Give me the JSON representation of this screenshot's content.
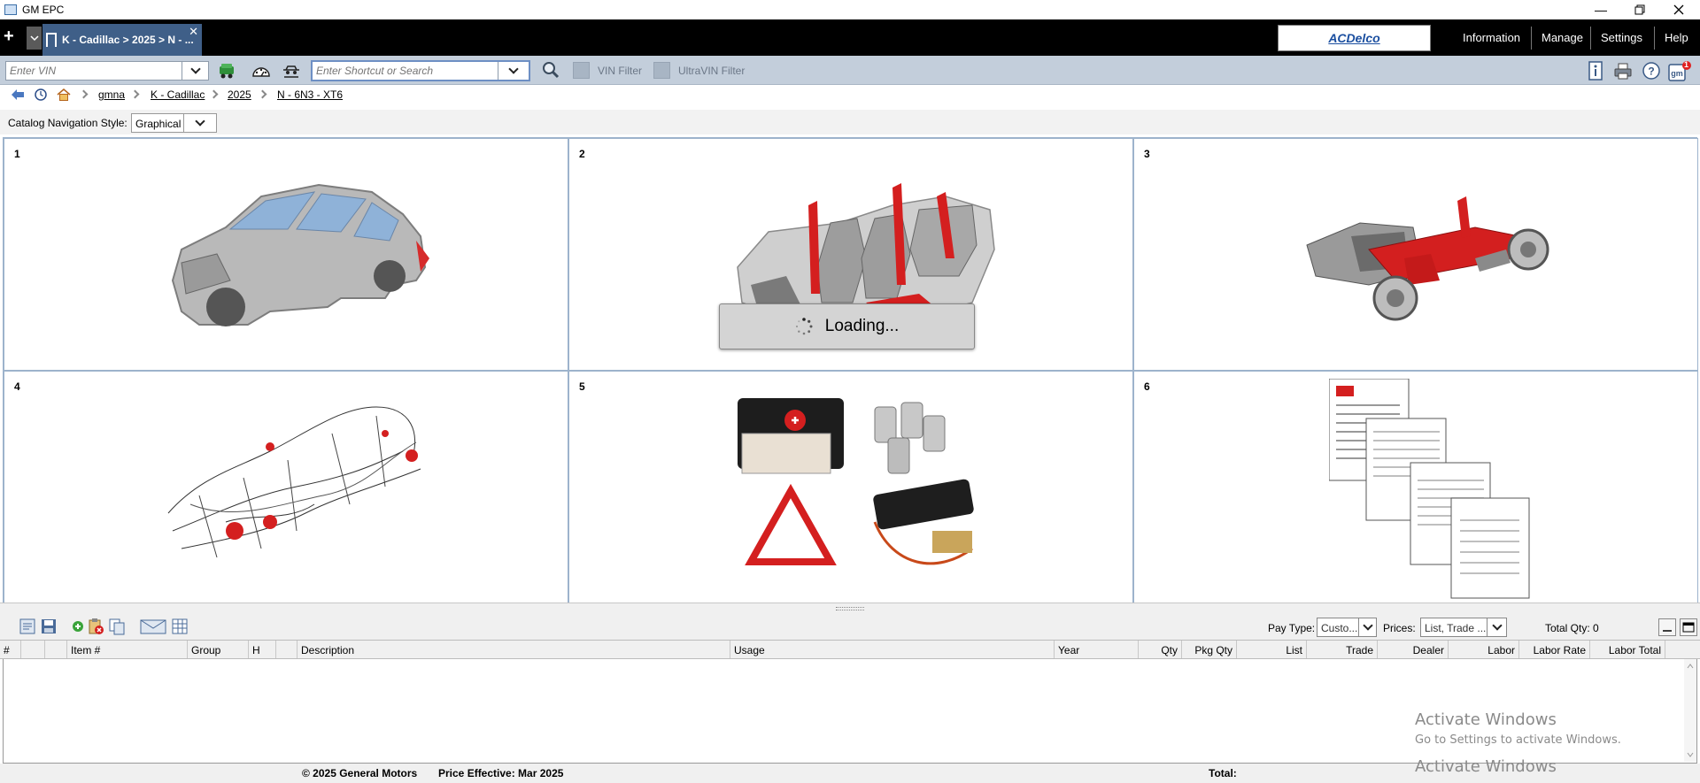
{
  "window": {
    "title": "GM EPC"
  },
  "topbar": {
    "tab_label": "K - Cadillac > 2025 > N - ...",
    "brand": "ACDelco",
    "nav": [
      "Information",
      "Manage",
      "Settings",
      "Help"
    ]
  },
  "toolbar": {
    "vin_placeholder": "Enter VIN",
    "search_placeholder": "Enter Shortcut or Search",
    "vin_filter_label": "VIN Filter",
    "ultravin_filter_label": "UltraVIN Filter",
    "notification_count": "1"
  },
  "breadcrumb": {
    "items": [
      "gmna",
      "K - Cadillac",
      "2025",
      "N - 6N3 - XT6"
    ]
  },
  "catalog_nav": {
    "label": "Catalog Navigation Style:",
    "value": "Graphical"
  },
  "catalog_grid": {
    "cells": [
      {
        "number": "1",
        "image": "vehicle-body-icon"
      },
      {
        "number": "2",
        "image": "interior-seats-icon"
      },
      {
        "number": "3",
        "image": "chassis-powertrain-icon"
      },
      {
        "number": "4",
        "image": "wiring-harness-icon"
      },
      {
        "number": "5",
        "image": "accessories-icon"
      },
      {
        "number": "6",
        "image": "documents-icon"
      }
    ],
    "loading_text": "Loading..."
  },
  "order_panel": {
    "pay_type_label": "Pay Type:",
    "pay_type_value": "Custo...",
    "prices_label": "Prices:",
    "prices_value": "List, Trade ...",
    "total_qty": "Total Qty: 0",
    "columns": [
      "#",
      "",
      "",
      "Item #",
      "Group",
      "H",
      "",
      "Description",
      "Usage",
      "Year",
      "Qty",
      "Pkg Qty",
      "List",
      "Trade",
      "Dealer",
      "Labor",
      "Labor Rate",
      "Labor Total"
    ]
  },
  "footer": {
    "copyright": "© 2025 General Motors",
    "price_effective": "Price Effective: Mar 2025",
    "total_label": "Total:"
  },
  "watermark": {
    "title": "Activate Windows",
    "subtitle": "Go to Settings to activate Windows.",
    "title_repeat": "Activate Windows"
  }
}
